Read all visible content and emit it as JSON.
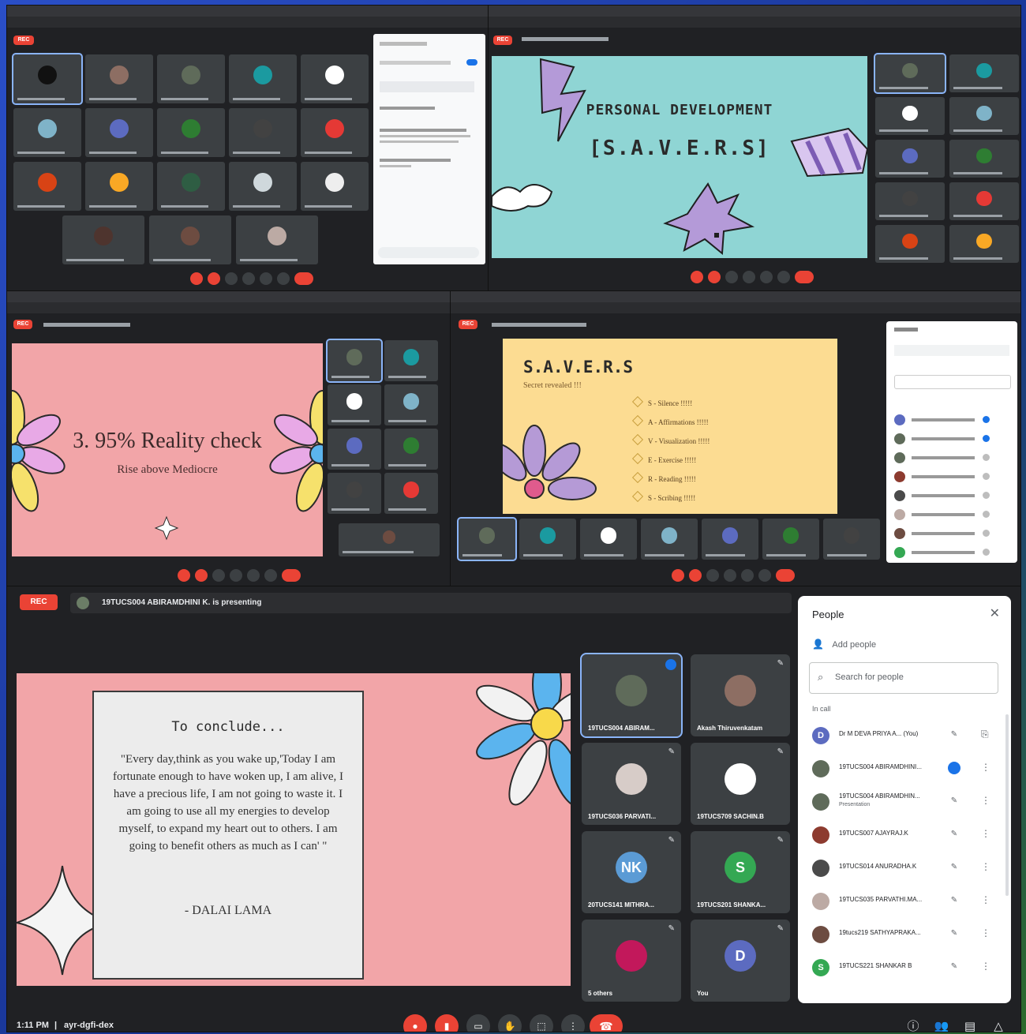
{
  "main": {
    "rec_label": "REC",
    "presenting_text": "19TUCS004 ABIRAMDHINI K. is presenting",
    "time": "1:11 PM",
    "separator": "|",
    "meeting_code": "ayr-dgfi-dex",
    "slide": {
      "title": "To conclude...",
      "quote": "\"Every day,think as you wake up,'Today I am fortunate enough to have woken up, I am alive, I have a precious life, I am not going to waste it. I am going to use all my energies to develop myself, to expand my heart out to others. I am going to benefit others as much as I can' \"",
      "author": "- DALAI LAMA",
      "colors": {
        "background": "#f2a5a8",
        "card": "#ececec",
        "petal_blue": "#5bb4ee",
        "center": "#f8d94a"
      }
    },
    "tiles": [
      {
        "name": "19TUCS004 ABIRAM...",
        "initial": "",
        "color": "#5f6b5a"
      },
      {
        "name": "Akash Thiruvenkatam",
        "initial": "",
        "color": "#8d6e63"
      },
      {
        "name": "19TUCS036 PARVATI...",
        "initial": "",
        "color": "#d7ccc8"
      },
      {
        "name": "19TUCS709 SACHIN.B",
        "initial": "",
        "color": "#ffffff"
      },
      {
        "name": "20TUCS141 MITHRA...",
        "initial": "NK",
        "color": "#5b9bd5"
      },
      {
        "name": "19TUCS201 SHANKA...",
        "initial": "S",
        "color": "#34a853"
      },
      {
        "name": "5 others",
        "initial": "",
        "color": "#c2185b"
      },
      {
        "name": "You",
        "initial": "D",
        "color": "#5c6bc0"
      }
    ],
    "people_panel": {
      "title": "People",
      "add_people": "Add people",
      "search_placeholder": "Search for people",
      "section": "In call",
      "rows": [
        {
          "name": "Dr M DEVA PRIYA A... (You)",
          "sub": "",
          "color": "#5c6bc0",
          "initial": "D"
        },
        {
          "name": "19TUCS004 ABIRAMDHINI...",
          "sub": "",
          "color": "#5f6b5a",
          "initial": ""
        },
        {
          "name": "19TUCS004 ABIRAMDHIN...",
          "sub": "Presentation",
          "color": "#5f6b5a",
          "initial": ""
        },
        {
          "name": "19TUCS007 AJAYRAJ.K",
          "sub": "",
          "color": "#8d3b2f",
          "initial": ""
        },
        {
          "name": "19TUCS014 ANURADHA.K",
          "sub": "",
          "color": "#4a4a4a",
          "initial": ""
        },
        {
          "name": "19TUCS035 PARVATHI.MA...",
          "sub": "",
          "color": "#bcaaa4",
          "initial": ""
        },
        {
          "name": "19tucs219 SATHYAPRAKA...",
          "sub": "",
          "color": "#6d4c41",
          "initial": ""
        },
        {
          "name": "19TUCS221 SHANKAR B",
          "sub": "",
          "color": "#34a853",
          "initial": "S"
        }
      ]
    }
  },
  "top_right": {
    "slide_title": "PERSONAL DEVELOPMENT",
    "slide_subtitle": "[S.A.V.E.R.S]",
    "colors": {
      "background": "#8fd5d4",
      "accent": "#b49ad8"
    }
  },
  "mid_left": {
    "slide_title": "3. 95% Reality check",
    "slide_subtitle": "Rise above Mediocre",
    "colors": {
      "background": "#f2a5a8",
      "petal_yellow": "#f6e16c"
    }
  },
  "mid_right": {
    "slide_title": "S.A.V.E.R.S",
    "slide_subtitle": "Secret revealed !!!",
    "items": [
      "S - Silence !!!!!",
      "A - Affirmations !!!!!",
      "V - Visualization !!!!!",
      "E - Exercise !!!!!",
      "R - Reading !!!!!",
      "S - Scribing !!!!!"
    ],
    "colors": {
      "background": "#fcdc92",
      "petal_purple": "#b59ad6"
    }
  },
  "icons": [
    "mic-off-icon",
    "camera-off-icon",
    "captions-icon",
    "raise-hand-icon",
    "present-icon",
    "more-icon",
    "end-call-icon",
    "info-icon",
    "people-icon",
    "chat-icon",
    "activities-icon",
    "close-icon",
    "add-person-icon",
    "search-icon",
    "pin-icon"
  ]
}
